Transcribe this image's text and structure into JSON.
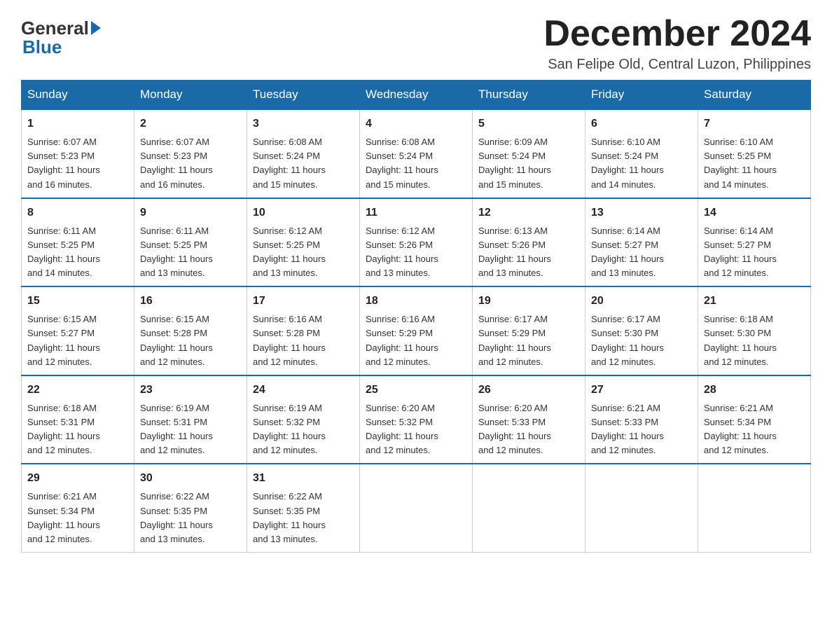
{
  "logo": {
    "general": "General",
    "blue": "Blue"
  },
  "title": "December 2024",
  "subtitle": "San Felipe Old, Central Luzon, Philippines",
  "days_of_week": [
    "Sunday",
    "Monday",
    "Tuesday",
    "Wednesday",
    "Thursday",
    "Friday",
    "Saturday"
  ],
  "weeks": [
    [
      {
        "day": "1",
        "sunrise": "6:07 AM",
        "sunset": "5:23 PM",
        "daylight": "11 hours and 16 minutes."
      },
      {
        "day": "2",
        "sunrise": "6:07 AM",
        "sunset": "5:23 PM",
        "daylight": "11 hours and 16 minutes."
      },
      {
        "day": "3",
        "sunrise": "6:08 AM",
        "sunset": "5:24 PM",
        "daylight": "11 hours and 15 minutes."
      },
      {
        "day": "4",
        "sunrise": "6:08 AM",
        "sunset": "5:24 PM",
        "daylight": "11 hours and 15 minutes."
      },
      {
        "day": "5",
        "sunrise": "6:09 AM",
        "sunset": "5:24 PM",
        "daylight": "11 hours and 15 minutes."
      },
      {
        "day": "6",
        "sunrise": "6:10 AM",
        "sunset": "5:24 PM",
        "daylight": "11 hours and 14 minutes."
      },
      {
        "day": "7",
        "sunrise": "6:10 AM",
        "sunset": "5:25 PM",
        "daylight": "11 hours and 14 minutes."
      }
    ],
    [
      {
        "day": "8",
        "sunrise": "6:11 AM",
        "sunset": "5:25 PM",
        "daylight": "11 hours and 14 minutes."
      },
      {
        "day": "9",
        "sunrise": "6:11 AM",
        "sunset": "5:25 PM",
        "daylight": "11 hours and 13 minutes."
      },
      {
        "day": "10",
        "sunrise": "6:12 AM",
        "sunset": "5:25 PM",
        "daylight": "11 hours and 13 minutes."
      },
      {
        "day": "11",
        "sunrise": "6:12 AM",
        "sunset": "5:26 PM",
        "daylight": "11 hours and 13 minutes."
      },
      {
        "day": "12",
        "sunrise": "6:13 AM",
        "sunset": "5:26 PM",
        "daylight": "11 hours and 13 minutes."
      },
      {
        "day": "13",
        "sunrise": "6:14 AM",
        "sunset": "5:27 PM",
        "daylight": "11 hours and 13 minutes."
      },
      {
        "day": "14",
        "sunrise": "6:14 AM",
        "sunset": "5:27 PM",
        "daylight": "11 hours and 12 minutes."
      }
    ],
    [
      {
        "day": "15",
        "sunrise": "6:15 AM",
        "sunset": "5:27 PM",
        "daylight": "11 hours and 12 minutes."
      },
      {
        "day": "16",
        "sunrise": "6:15 AM",
        "sunset": "5:28 PM",
        "daylight": "11 hours and 12 minutes."
      },
      {
        "day": "17",
        "sunrise": "6:16 AM",
        "sunset": "5:28 PM",
        "daylight": "11 hours and 12 minutes."
      },
      {
        "day": "18",
        "sunrise": "6:16 AM",
        "sunset": "5:29 PM",
        "daylight": "11 hours and 12 minutes."
      },
      {
        "day": "19",
        "sunrise": "6:17 AM",
        "sunset": "5:29 PM",
        "daylight": "11 hours and 12 minutes."
      },
      {
        "day": "20",
        "sunrise": "6:17 AM",
        "sunset": "5:30 PM",
        "daylight": "11 hours and 12 minutes."
      },
      {
        "day": "21",
        "sunrise": "6:18 AM",
        "sunset": "5:30 PM",
        "daylight": "11 hours and 12 minutes."
      }
    ],
    [
      {
        "day": "22",
        "sunrise": "6:18 AM",
        "sunset": "5:31 PM",
        "daylight": "11 hours and 12 minutes."
      },
      {
        "day": "23",
        "sunrise": "6:19 AM",
        "sunset": "5:31 PM",
        "daylight": "11 hours and 12 minutes."
      },
      {
        "day": "24",
        "sunrise": "6:19 AM",
        "sunset": "5:32 PM",
        "daylight": "11 hours and 12 minutes."
      },
      {
        "day": "25",
        "sunrise": "6:20 AM",
        "sunset": "5:32 PM",
        "daylight": "11 hours and 12 minutes."
      },
      {
        "day": "26",
        "sunrise": "6:20 AM",
        "sunset": "5:33 PM",
        "daylight": "11 hours and 12 minutes."
      },
      {
        "day": "27",
        "sunrise": "6:21 AM",
        "sunset": "5:33 PM",
        "daylight": "11 hours and 12 minutes."
      },
      {
        "day": "28",
        "sunrise": "6:21 AM",
        "sunset": "5:34 PM",
        "daylight": "11 hours and 12 minutes."
      }
    ],
    [
      {
        "day": "29",
        "sunrise": "6:21 AM",
        "sunset": "5:34 PM",
        "daylight": "11 hours and 12 minutes."
      },
      {
        "day": "30",
        "sunrise": "6:22 AM",
        "sunset": "5:35 PM",
        "daylight": "11 hours and 13 minutes."
      },
      {
        "day": "31",
        "sunrise": "6:22 AM",
        "sunset": "5:35 PM",
        "daylight": "11 hours and 13 minutes."
      },
      null,
      null,
      null,
      null
    ]
  ],
  "labels": {
    "sunrise": "Sunrise:",
    "sunset": "Sunset:",
    "daylight": "Daylight:"
  }
}
